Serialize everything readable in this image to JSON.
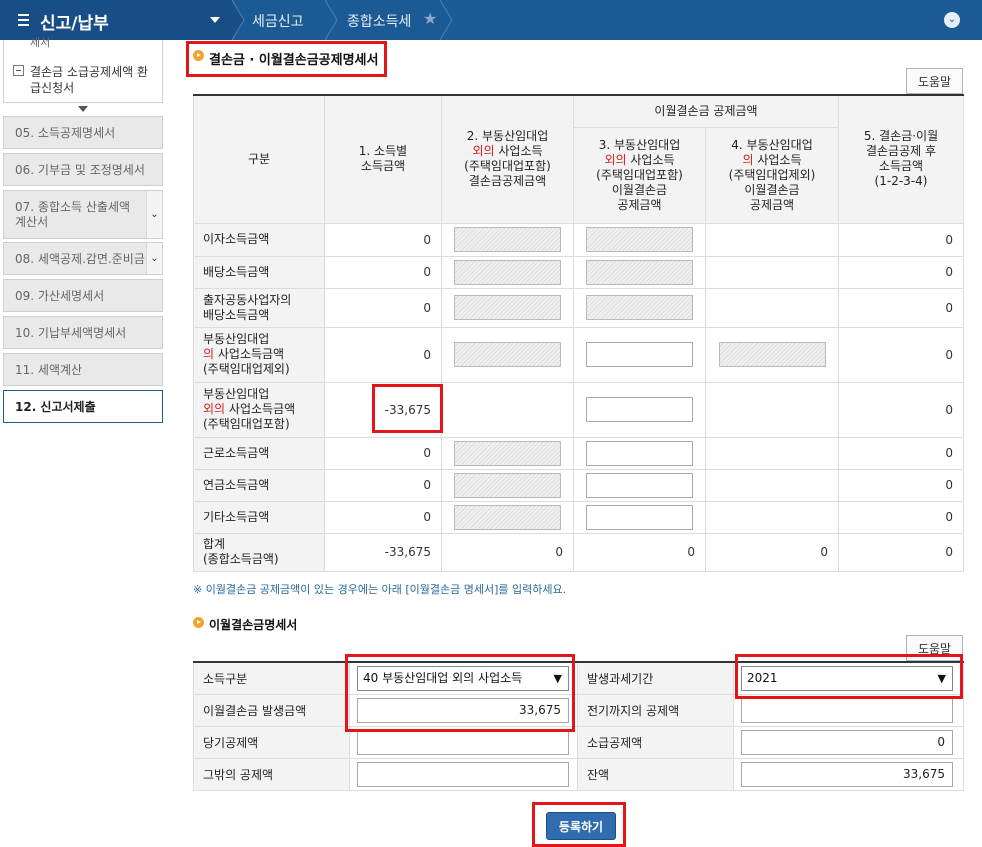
{
  "topbar": {
    "menu_title": "신고/납부",
    "breadcrumbs": [
      "세금신고",
      "종합소득세"
    ]
  },
  "sidebar": {
    "clipped_text": "세서",
    "sub_item": "결손금 소급공제세액 환급신청서",
    "items": [
      {
        "label": "05. 소득공제명세서",
        "state": "disabled"
      },
      {
        "label": "06. 기부금 및 조정명세서",
        "state": "disabled"
      },
      {
        "label": "07. 종합소득 산출세액계산서",
        "state": "disabled",
        "dropdown": true
      },
      {
        "label": "08. 세액공제.감면.준비금",
        "state": "disabled",
        "dropdown": true
      },
      {
        "label": "09. 가산세명세서",
        "state": "disabled"
      },
      {
        "label": "10. 기납부세액명세서",
        "state": "disabled"
      },
      {
        "label": "11. 세액계산",
        "state": "disabled"
      },
      {
        "label": "12. 신고서제출",
        "state": "active"
      }
    ]
  },
  "section1": {
    "title": "결손금 · 이월결손금공제명세서",
    "help_label": "도움말",
    "headers": {
      "category": "구분",
      "col1": "1. 소득별 소득금액",
      "col2_line1": "2. 부동산임대업",
      "col2_red": "외의",
      "col2_line2": " 사업소득",
      "col2_line3": "(주택임대업포함)",
      "col2_line4": "결손금공제금액",
      "carryover_group": "이월결손금 공제금액",
      "col3_line1": "3. 부동산임대업",
      "col3_red": "외의",
      "col3_line2": " 사업소득",
      "col3_line3": "(주택임대업포함)",
      "col3_line4": "이월결손금",
      "col3_line5": "공제금액",
      "col4_line1": "4. 부동산임대업",
      "col4_red": "의",
      "col4_line2": " 사업소득",
      "col4_line3": "(주택임대업제외)",
      "col4_line4": "이월결손금",
      "col4_line5": "공제금액",
      "col5_line1": "5. 결손금·이월",
      "col5_line2": "결손금공제 후",
      "col5_line3": "소득금액",
      "col5_line4": "(1-2-3-4)"
    },
    "rows": [
      {
        "label": "이자소득금액",
        "c1": "0",
        "c5": "0"
      },
      {
        "label": "배당소득금액",
        "c1": "0",
        "c5": "0"
      },
      {
        "label_a": "출자공동사업자의",
        "label_b": "배당소득금액",
        "c1": "0",
        "c5": "0"
      },
      {
        "label_a": "부동산임대업",
        "label_red": "의",
        "label_b": " 사업소득금액",
        "label_c": "(주택임대업제외)",
        "c1": "0",
        "c5": "0"
      },
      {
        "label_a": "부동산임대업",
        "label_red": "외의",
        "label_b": " 사업소득금액",
        "label_c": "(주택임대업포함)",
        "c1": "-33,675",
        "c5": "0"
      },
      {
        "label": "근로소득금액",
        "c1": "0",
        "c5": "0"
      },
      {
        "label": "연금소득금액",
        "c1": "0",
        "c5": "0"
      },
      {
        "label": "기타소득금액",
        "c1": "0",
        "c5": "0"
      }
    ],
    "total": {
      "label_a": "합계",
      "label_b": "(종합소득금액)",
      "c1": "-33,675",
      "c2": "0",
      "c3": "0",
      "c4": "0",
      "c5": "0"
    },
    "note": "※ 이월결손금 공제금액이 있는 경우에는 아래 [이월결손금 명세서]를 입력하세요."
  },
  "section2": {
    "title": "이월결손금명세서",
    "help_label": "도움말",
    "income_type_label": "소득구분",
    "income_type_value": "40 부동산임대업 외의 사업소득",
    "tax_period_label": "발생과세기간",
    "tax_period_value": "2021",
    "loss_amount_label": "이월결손금 발생금액",
    "loss_amount_value": "33,675",
    "prior_deduction_label": "전기까지의 공제액",
    "prior_deduction_value": "",
    "current_deduction_label": "당기공제액",
    "current_deduction_value": "",
    "carryback_label": "소급공제액",
    "carryback_value": "0",
    "other_deduction_label": "그밖의 공제액",
    "other_deduction_value": "",
    "balance_label": "잔액",
    "balance_value": "33,675"
  },
  "register_label": "등록하기",
  "colors": {
    "topbar": "#1c5a96",
    "highlight": "#e0161b",
    "button": "#2f6db0",
    "bullet": "#f0a429"
  }
}
